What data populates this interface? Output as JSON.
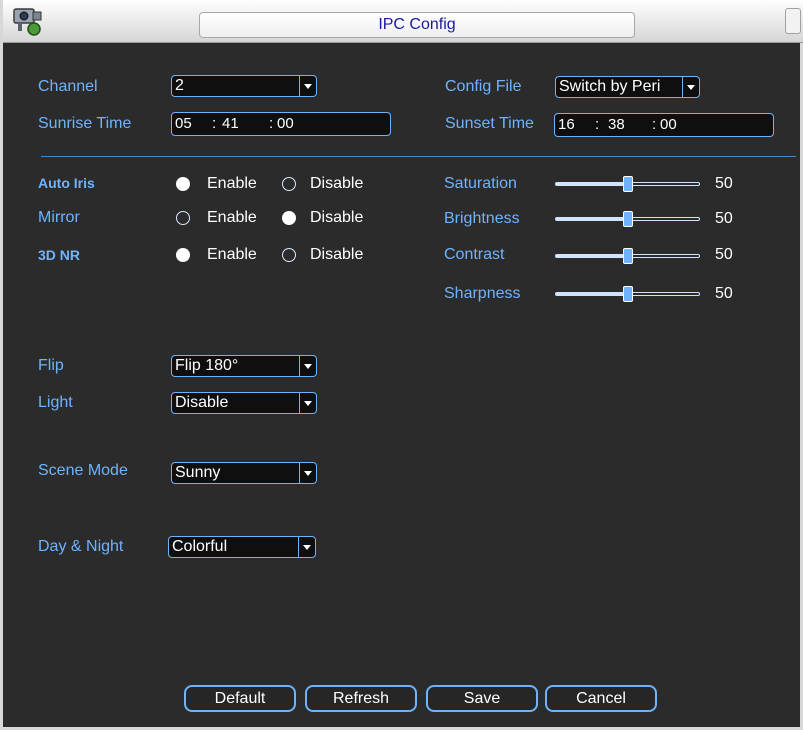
{
  "window": {
    "title": "IPC Config"
  },
  "top": {
    "channel": {
      "label": "Channel",
      "value": "2"
    },
    "sunrise": {
      "label": "Sunrise Time",
      "hh": "05",
      "mm": "41",
      "ss": "00"
    },
    "config_file": {
      "label": "Config File",
      "value": "Switch by Peri"
    },
    "sunset": {
      "label": "Sunset Time",
      "hh": "16",
      "mm": "38",
      "ss": "00"
    }
  },
  "toggles": {
    "enable_label": "Enable",
    "disable_label": "Disable",
    "auto_iris": {
      "label": "Auto Iris",
      "selected": "Enable"
    },
    "mirror": {
      "label": "Mirror",
      "selected": "Disable"
    },
    "nr3d": {
      "label": "3D NR",
      "selected": "Enable"
    }
  },
  "sliders": {
    "saturation": {
      "label": "Saturation",
      "value": "50"
    },
    "brightness": {
      "label": "Brightness",
      "value": "50"
    },
    "contrast": {
      "label": "Contrast",
      "value": "50"
    },
    "sharpness": {
      "label": "Sharpness",
      "value": "50"
    }
  },
  "options": {
    "flip": {
      "label": "Flip",
      "value": "Flip 180°"
    },
    "light": {
      "label": "Light",
      "value": "Disable"
    },
    "scene_mode": {
      "label": "Scene Mode",
      "value": "Sunny"
    },
    "day_night": {
      "label": "Day & Night",
      "value": "Colorful"
    }
  },
  "buttons": {
    "default": "Default",
    "refresh": "Refresh",
    "save": "Save",
    "cancel": "Cancel"
  },
  "colors": {
    "label": "#6fb3ff",
    "background": "#2b2b2b",
    "title": "#1a1aa0"
  }
}
